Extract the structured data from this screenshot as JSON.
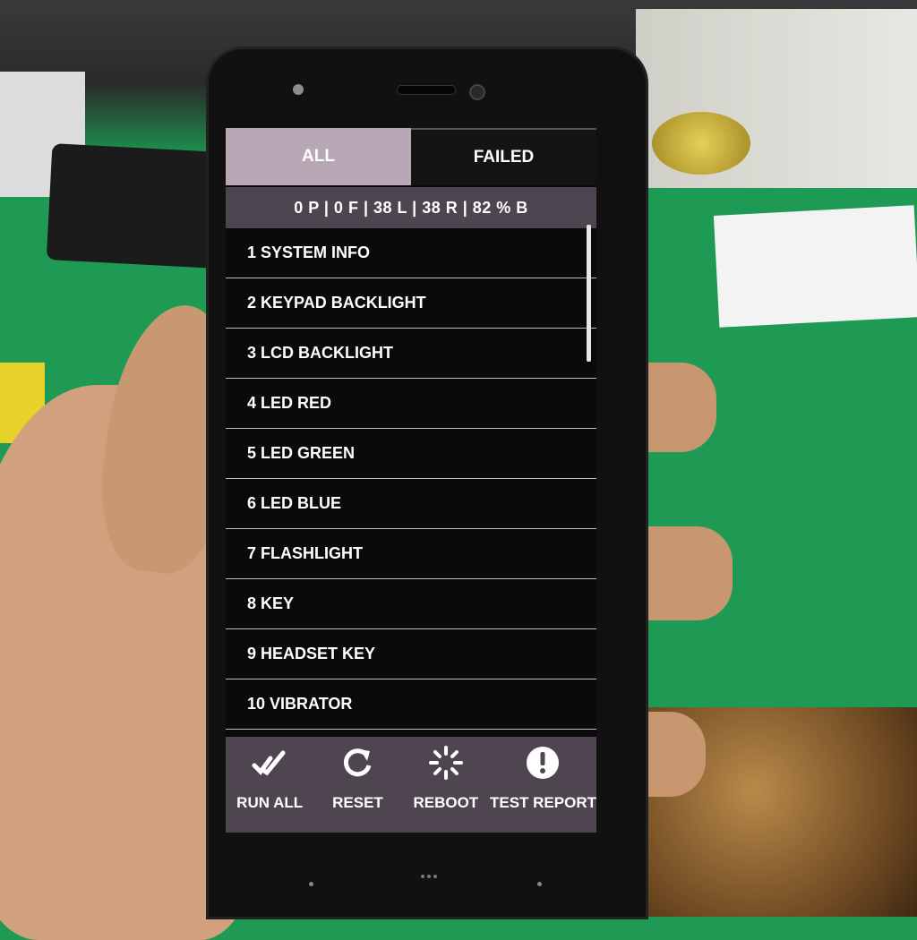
{
  "tabs": [
    {
      "label": "ALL",
      "selected": true
    },
    {
      "label": "FAILED",
      "selected": false
    }
  ],
  "status_line": "0 P | 0 F  | 38 L  | 38 R  | 82 % B",
  "test_items": [
    "1 SYSTEM INFO",
    "2 KEYPAD BACKLIGHT",
    "3 LCD BACKLIGHT",
    "4 LED RED",
    "5 LED GREEN",
    "6 LED BLUE",
    "7 FLASHLIGHT",
    "8 KEY",
    "9 HEADSET KEY",
    "10 VIBRATOR"
  ],
  "actions": [
    {
      "label": "RUN ALL",
      "icon": "double-check-icon"
    },
    {
      "label": "RESET",
      "icon": "refresh-icon"
    },
    {
      "label": "REBOOT",
      "icon": "spinner-icon"
    },
    {
      "label": "TEST REPORT",
      "icon": "exclamation-icon"
    }
  ],
  "colors": {
    "tab_selected": "#b8a8b6",
    "status_bar": "#4d4650",
    "bottom_bar": "#4e4550",
    "list_bg": "#0a0a0a"
  }
}
